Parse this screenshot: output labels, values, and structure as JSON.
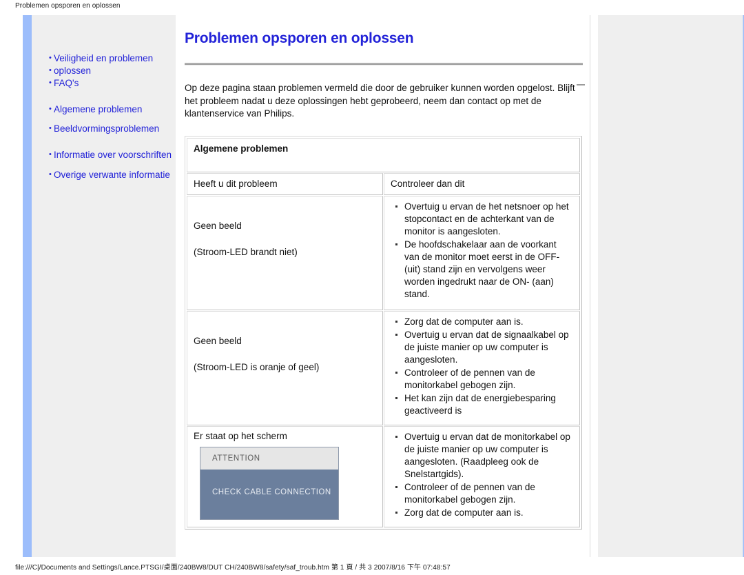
{
  "print": {
    "header_title": "Problemen opsporen en oplossen",
    "footer_path": "file:///C|/Documents and Settings/Lance.PTSGI/桌面/240BW8/DUT CH/240BW8/safety/saf_troub.htm 第 1 頁 / 共 3 2007/8/16 下午 07:48:57"
  },
  "sidebar": {
    "items": [
      {
        "label": "Veiligheid en problemen"
      },
      {
        "label": "oplossen"
      },
      {
        "label": "FAQ's"
      },
      {
        "label": "Algemene problemen"
      },
      {
        "label": "Beeldvormingsproblemen"
      },
      {
        "label": "Informatie over voorschriften"
      },
      {
        "label": "Overige verwante informatie"
      }
    ]
  },
  "main": {
    "title": "Problemen opsporen en oplossen",
    "intro": "Op deze pagina staan problemen vermeld die door de gebruiker kunnen worden opgelost. Blijft het probleem nadat u deze oplossingen hebt geprobeerd, neem dan contact op met de klantenservice van Philips.",
    "table": {
      "section_heading": "Algemene problemen",
      "columns": {
        "left": "Heeft u dit probleem",
        "right": "Controleer dan dit"
      },
      "rows": [
        {
          "problem_line1": "Geen beeld",
          "problem_line2": "(Stroom-LED brandt niet)",
          "checks": [
            "Overtuig u ervan de het netsnoer op het stopcontact en de achterkant van de monitor is aangesloten.",
            "De hoofdschakelaar aan de voorkant van de monitor moet eerst in de OFF- (uit) stand zijn en vervolgens weer worden ingedrukt naar de ON- (aan) stand."
          ]
        },
        {
          "problem_line1": "Geen beeld",
          "problem_line2": "(Stroom-LED is oranje of geel)",
          "checks": [
            "Zorg dat de computer aan is.",
            "Overtuig u ervan dat de signaalkabel op de juiste manier op uw computer is aangesloten.",
            "Controleer of de pennen van de monitorkabel gebogen zijn.",
            "Het kan zijn dat de energiebesparing geactiveerd is"
          ]
        },
        {
          "problem_line1": "Er staat op het scherm",
          "problem_line2": "",
          "image": {
            "top_label": "ATTENTION",
            "body_label": "CHECK CABLE CONNECTION",
            "top_bg": "#e6e6e6",
            "body_bg": "#6b7f9d"
          },
          "checks": [
            "Overtuig u ervan dat de monitorkabel op de juiste manier op uw computer is aangesloten. (Raadpleeg ook de Snelstartgids).",
            "Controleer of de pennen van de monitorkabel gebogen zijn.",
            "Zorg dat de computer aan is."
          ]
        }
      ]
    }
  },
  "colors": {
    "link_blue": "#2222d8",
    "heading_blue": "#2222d8",
    "column_head_blue": "#5b5bf0",
    "panel_gray": "#efefef",
    "accent_blue": "#9cbdfb"
  }
}
